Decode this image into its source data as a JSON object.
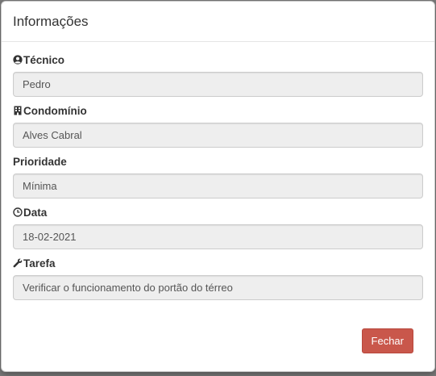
{
  "modal": {
    "title": "Informações",
    "fields": [
      {
        "label": "Técnico",
        "icon": "user-circle-icon",
        "value": "Pedro"
      },
      {
        "label": "Condomínio",
        "icon": "building-icon",
        "value": "Alves Cabral"
      },
      {
        "label": "Prioridade",
        "icon": "",
        "value": "Mínima"
      },
      {
        "label": "Data",
        "icon": "clock-icon",
        "value": "18-02-2021"
      },
      {
        "label": "Tarefa",
        "icon": "wrench-icon",
        "value": "Verificar o funcionamento do portão do térreo"
      }
    ],
    "close_label": "Fechar"
  },
  "colors": {
    "close_button": "#c9574b",
    "field_background": "#eeeeee"
  }
}
